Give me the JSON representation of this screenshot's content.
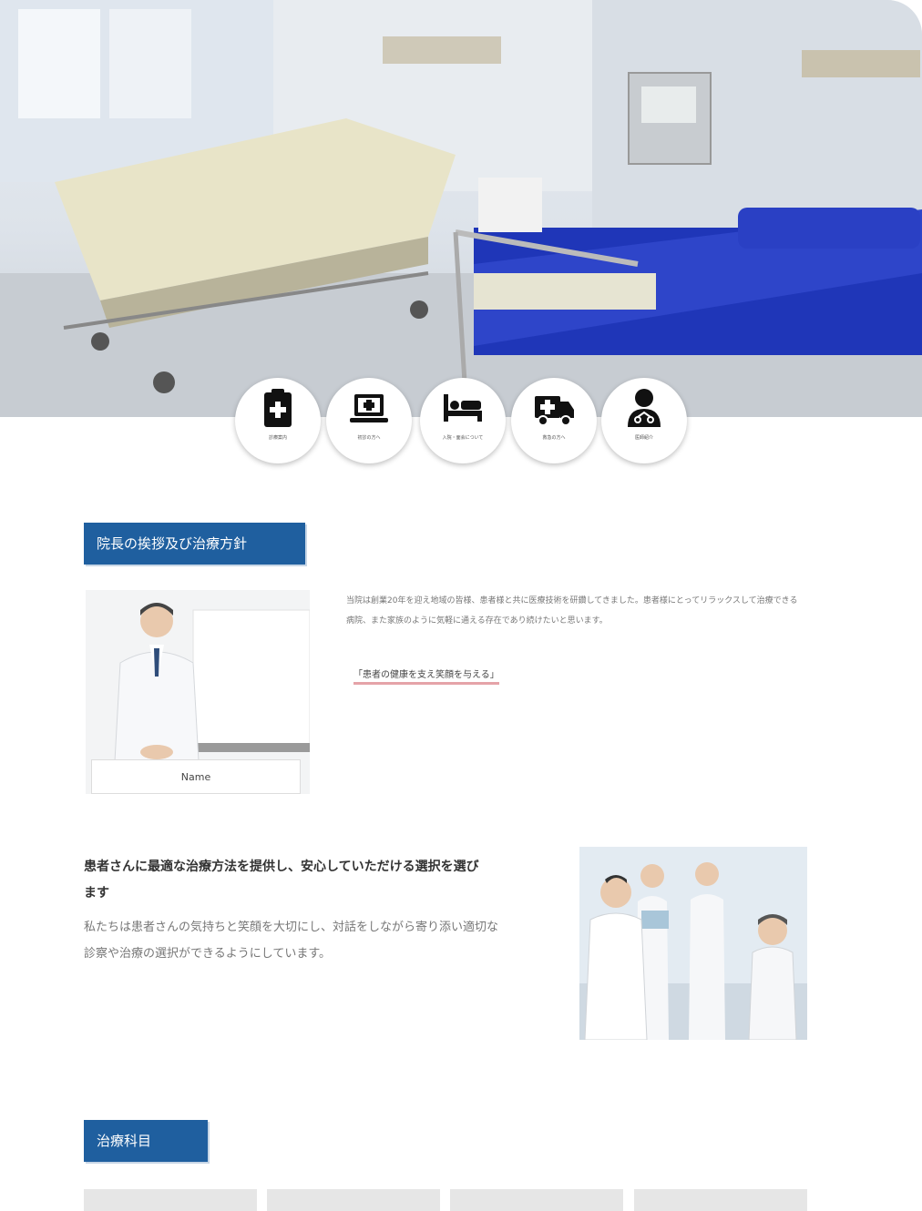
{
  "icons": [
    {
      "name": "clipboard-medical-icon",
      "label": "診療案内"
    },
    {
      "name": "laptop-medical-icon",
      "label": "初診の方へ"
    },
    {
      "name": "bed-icon",
      "label": "入院・面会について"
    },
    {
      "name": "ambulance-icon",
      "label": "救急の方へ"
    },
    {
      "name": "doctor-icon",
      "label": "医師紹介"
    }
  ],
  "director": {
    "heading": "院長の挨拶及び治療方針",
    "name": "Name",
    "body": "当院は創業20年を迎え地域の皆様、患者様と共に医療技術を研鑽してきました。患者様にとってリラックスして治療できる病院、また家族のように気軽に通える存在であり続けたいと思います。",
    "link": "「患者の健康を支え笑顔を与える」"
  },
  "care": {
    "title": "患者さんに最適な治療方法を提供し、安心していただける選択を選びます",
    "body": "私たちは患者さんの気持ちと笑顔を大切にし、対話をしながら寄り添い適切な診察や治療の選択ができるようにしています。"
  },
  "subjects": {
    "heading": "治療科目",
    "tabs": [
      "",
      "",
      "",
      ""
    ]
  },
  "colors": {
    "accent": "#1f5f9f",
    "link_underline": "#e5a3a8"
  }
}
